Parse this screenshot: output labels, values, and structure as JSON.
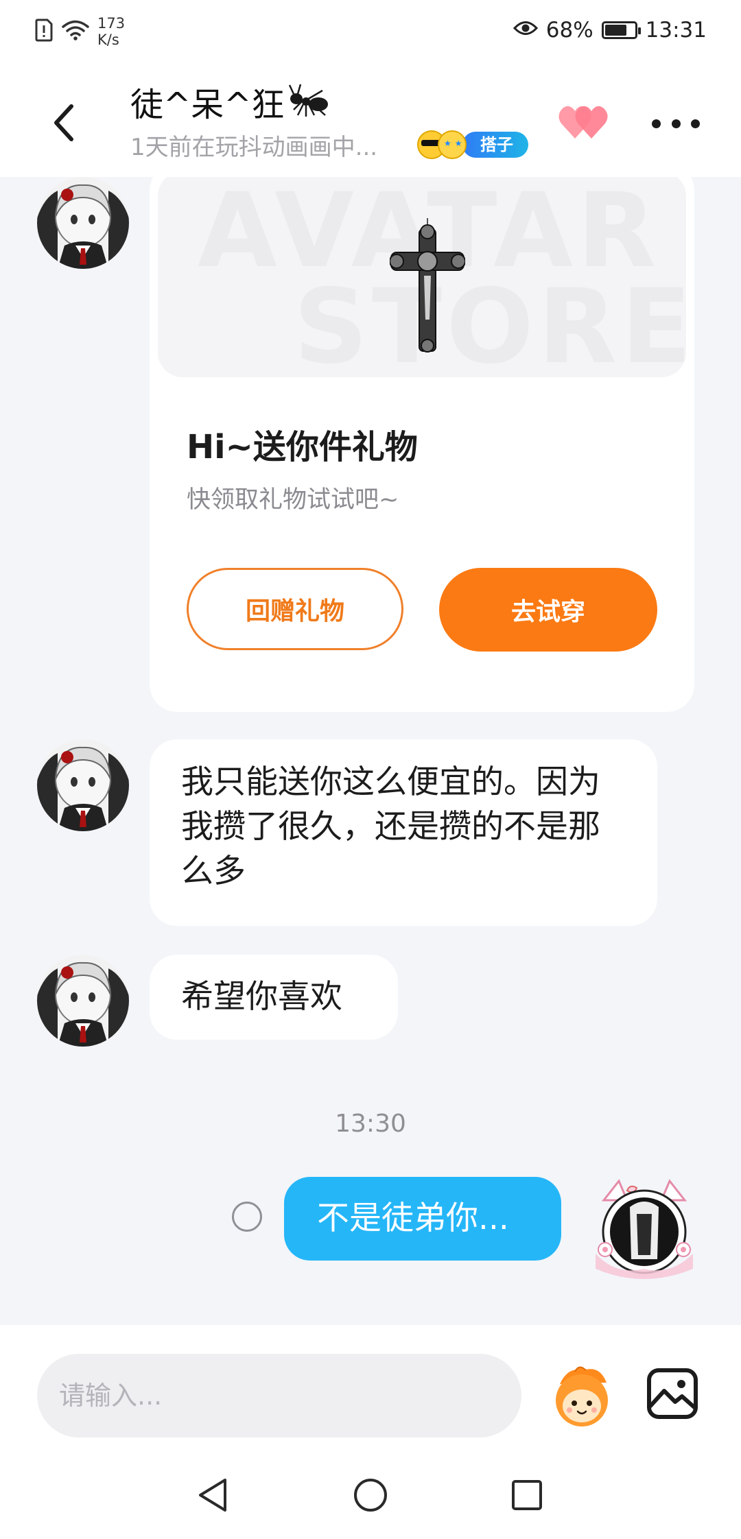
{
  "status_bar": {
    "network_speed_value": "173",
    "network_speed_unit": "K/s",
    "battery_percent": "68%",
    "battery_level": 0.68,
    "time": "13:31",
    "icons": [
      "sim-alert-icon",
      "wifi-icon",
      "eye-icon",
      "battery-icon"
    ]
  },
  "header": {
    "contact_name": "徒^呆^狂",
    "name_icon": "ant-icon",
    "contact_status": "1天前在玩抖动画画中...",
    "relation_badge": "搭子",
    "icons": [
      "back-icon",
      "heart-icon",
      "more-icon"
    ]
  },
  "messages": {
    "gift_card": {
      "watermark_line1": "AVATAR",
      "watermark_line2": "STORE",
      "title": "Hi~送你件礼物",
      "subtitle": "快领取礼物试试吧~",
      "return_gift_button": "回赠礼物",
      "try_on_button": "去试穿"
    },
    "text_1": "我只能送你这么便宜的。因为我攒了很久，还是攒的不是那么多",
    "text_2": "希望你喜欢",
    "timestamp": "13:30",
    "my_text": "不是徒弟你..."
  },
  "input_bar": {
    "placeholder": "请输入..."
  },
  "colors": {
    "accent_orange": "#fb7a13",
    "my_bubble_blue": "#25b6f8",
    "badge_blue": "#2f7cf6",
    "chat_background": "#f3f5f9"
  }
}
